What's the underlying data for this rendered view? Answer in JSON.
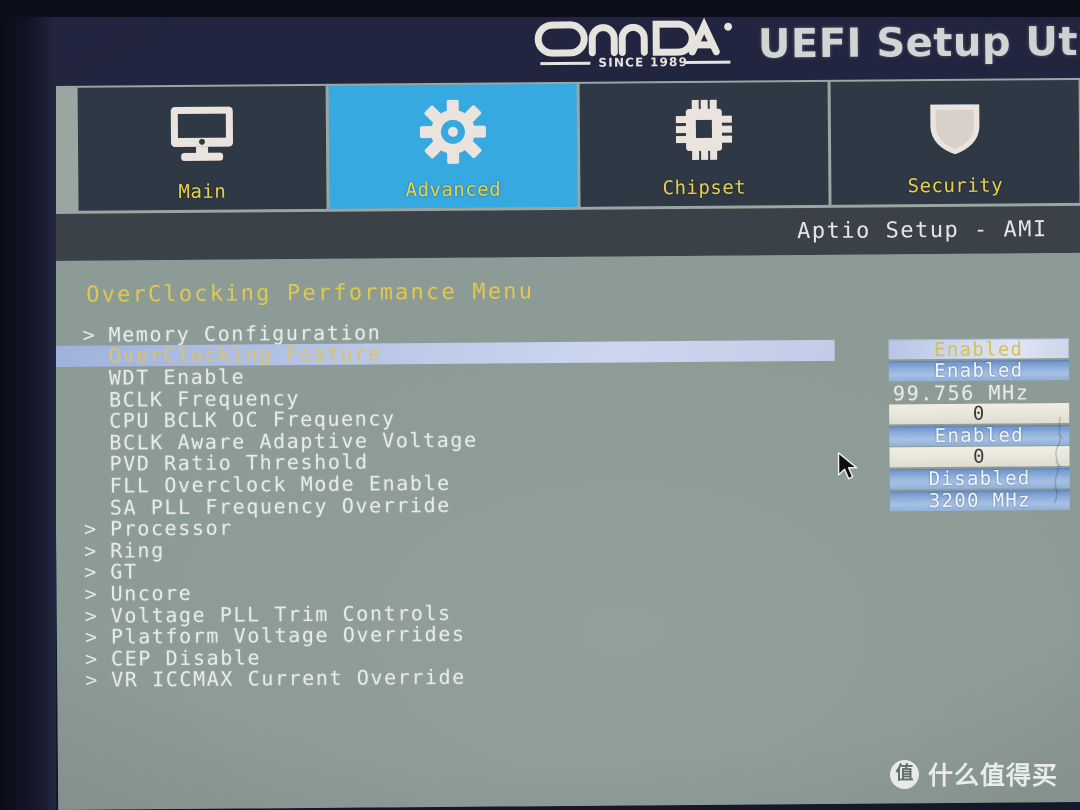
{
  "header": {
    "brand": "ONDA",
    "brand_tagline": "SINCE 1989",
    "title": "UEFI Setup Uti"
  },
  "tabs": [
    {
      "label": "Main",
      "icon": "monitor-icon",
      "active": false
    },
    {
      "label": "Advanced",
      "icon": "gear-icon",
      "active": true
    },
    {
      "label": "Chipset",
      "icon": "chip-icon",
      "active": false
    },
    {
      "label": "Security",
      "icon": "shield-icon",
      "active": false
    }
  ],
  "aptio_bar": "Aptio Setup - AMI",
  "page": {
    "section_title": "OverClocking Performance Menu",
    "rows": [
      {
        "caret": ">",
        "label": "Memory Configuration",
        "value": "",
        "value_kind": "none",
        "highlight": false
      },
      {
        "caret": "",
        "label": "OverClocking Feature",
        "value": "Enabled",
        "value_kind": "selected",
        "highlight": true
      },
      {
        "caret": "",
        "label": "WDT Enable",
        "value": "Enabled",
        "value_kind": "select",
        "highlight": false
      },
      {
        "caret": "",
        "label": "BCLK Frequency",
        "value": "99.756 MHz",
        "value_kind": "plain",
        "highlight": false
      },
      {
        "caret": "",
        "label": "CPU BCLK OC Frequency",
        "value": "0",
        "value_kind": "input",
        "highlight": false
      },
      {
        "caret": "",
        "label": "BCLK Aware Adaptive Voltage",
        "value": "Enabled",
        "value_kind": "select",
        "highlight": false
      },
      {
        "caret": "",
        "label": "PVD Ratio Threshold",
        "value": "0",
        "value_kind": "input",
        "highlight": false
      },
      {
        "caret": "",
        "label": "FLL Overclock Mode Enable",
        "value": "Disabled",
        "value_kind": "select",
        "highlight": false
      },
      {
        "caret": "",
        "label": "SA PLL Frequency Override",
        "value": "3200 MHz",
        "value_kind": "select",
        "highlight": false
      },
      {
        "caret": ">",
        "label": "Processor",
        "value": "",
        "value_kind": "none",
        "highlight": false
      },
      {
        "caret": ">",
        "label": "Ring",
        "value": "",
        "value_kind": "none",
        "highlight": false
      },
      {
        "caret": ">",
        "label": "GT",
        "value": "",
        "value_kind": "none",
        "highlight": false
      },
      {
        "caret": ">",
        "label": "Uncore",
        "value": "",
        "value_kind": "none",
        "highlight": false
      },
      {
        "caret": ">",
        "label": "Voltage PLL Trim Controls",
        "value": "",
        "value_kind": "none",
        "highlight": false
      },
      {
        "caret": ">",
        "label": "Platform Voltage Overrides",
        "value": "",
        "value_kind": "none",
        "highlight": false
      },
      {
        "caret": ">",
        "label": "CEP Disable",
        "value": "",
        "value_kind": "none",
        "highlight": false
      },
      {
        "caret": ">",
        "label": "VR ICCMAX Current Override",
        "value": "",
        "value_kind": "none",
        "highlight": false
      }
    ]
  },
  "cursor": {
    "icon": "mouse-pointer-icon"
  },
  "watermark": {
    "badge": "值",
    "text": "什么值得买"
  },
  "colors": {
    "titlebar": "#22253f",
    "tab_active": "#36a9e1",
    "tab_inactive": "#2f3845",
    "tab_label": "#e8d24a",
    "content_bg": "#8d9b97",
    "section_title": "#e0c94a",
    "row_text": "#e6ecea",
    "select_widget": "#8fb0dc",
    "input_widget": "#e8e6da"
  }
}
